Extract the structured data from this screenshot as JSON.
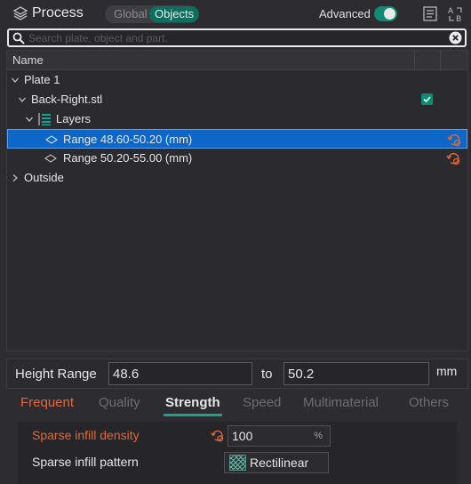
{
  "header": {
    "title": "Process",
    "segment": {
      "global_label": "Global",
      "objects_label": "Objects",
      "selected": "Objects"
    },
    "advanced_label": "Advanced",
    "advanced_on": true,
    "accent": "#0f8a74",
    "icons": [
      "layers-icon",
      "document-icon",
      "sort-az-icon"
    ]
  },
  "search": {
    "placeholder": "Search plate, object and part.",
    "value": ""
  },
  "tree": {
    "header_name": "Name",
    "rows": [
      {
        "label": "Plate 1",
        "expanded": true
      },
      {
        "label": "Back-Right.stl",
        "expanded": true,
        "checked": true
      },
      {
        "label": "Layers",
        "expanded": true
      },
      {
        "label": "Range 48.60-50.20 (mm)",
        "selected": true
      },
      {
        "label": "Range 50.20-55.00 (mm)",
        "selected": false
      },
      {
        "label": "Outside",
        "expanded": false
      }
    ]
  },
  "height_range": {
    "label": "Height Range",
    "from": "48.6",
    "to_label": "to",
    "to": "50.2",
    "unit": "mm"
  },
  "tabs": [
    {
      "label": "Frequent",
      "modified": true
    },
    {
      "label": "Quality",
      "modified": false
    },
    {
      "label": "Strength",
      "active": true
    },
    {
      "label": "Speed",
      "modified": false
    },
    {
      "label": "Multimaterial",
      "modified": false
    },
    {
      "label": "Others",
      "modified": false
    }
  ],
  "settings": [
    {
      "label": "Sparse infill density",
      "value": "100",
      "unit": "%",
      "modified": true
    },
    {
      "label": "Sparse infill pattern",
      "value": "Rectilinear",
      "modified": false
    }
  ],
  "colors": {
    "selection": "#0c67c8",
    "modified": "#e0683a",
    "accent": "#14a58a"
  }
}
